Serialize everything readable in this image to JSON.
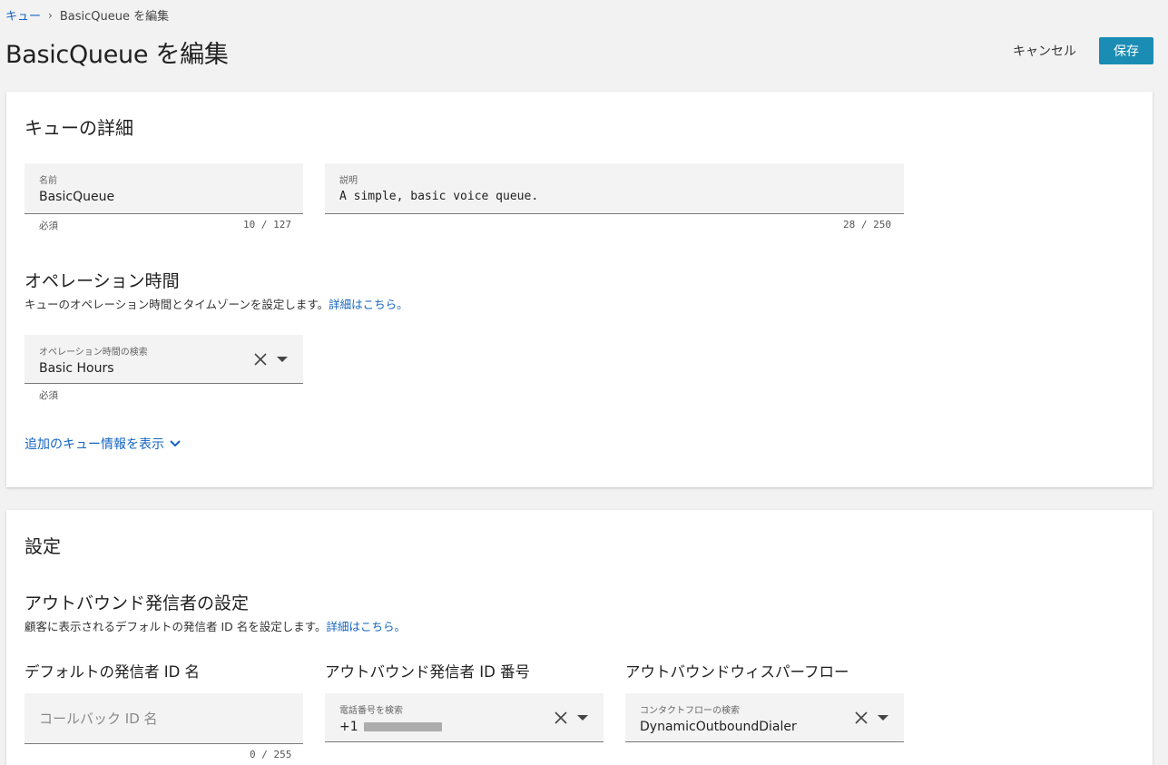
{
  "breadcrumb": {
    "parent": "キュー",
    "separator": "›",
    "current": "BasicQueue を編集"
  },
  "page_title": "BasicQueue を編集",
  "actions": {
    "cancel": "キャンセル",
    "save": "保存"
  },
  "queue_details": {
    "title": "キューの詳細",
    "name_field": {
      "label": "名前",
      "value": "BasicQueue",
      "helper": "必須",
      "counter": "10 / 127"
    },
    "description_field": {
      "label": "説明",
      "value": "A simple, basic voice queue.",
      "counter": "28 / 250"
    },
    "hours": {
      "title": "オペレーション時間",
      "desc": "キューのオペレーション時間とタイムゾーンを設定します。",
      "link": "詳細はこちら。",
      "field_label": "オペレーション時間の検索",
      "field_value": "Basic Hours",
      "helper": "必須"
    },
    "show_more": "追加のキュー情報を表示"
  },
  "settings": {
    "title": "設定",
    "outbound": {
      "title": "アウトバウンド発信者の設定",
      "desc": "顧客に表示されるデフォルトの発信者 ID 名を設定します。",
      "link": "詳細はこちら。"
    },
    "caller_id_name": {
      "title": "デフォルトの発信者 ID 名",
      "placeholder": "コールバック ID 名",
      "counter": "0 / 255"
    },
    "caller_id_number": {
      "title": "アウトバウンド発信者 ID 番号",
      "label": "電話番号を検索",
      "value_prefix": "+1"
    },
    "whisper_flow": {
      "title": "アウトバウンドウィスパーフロー",
      "label": "コンタクトフローの検索",
      "value": "DynamicOutboundDialer"
    }
  },
  "colors": {
    "accent": "#1b8db4",
    "link": "#1565c0",
    "background": "#f2f2f2"
  },
  "icons": [
    "chevron-right-icon",
    "clear-icon",
    "dropdown-arrow-icon",
    "chevron-down-icon"
  ]
}
